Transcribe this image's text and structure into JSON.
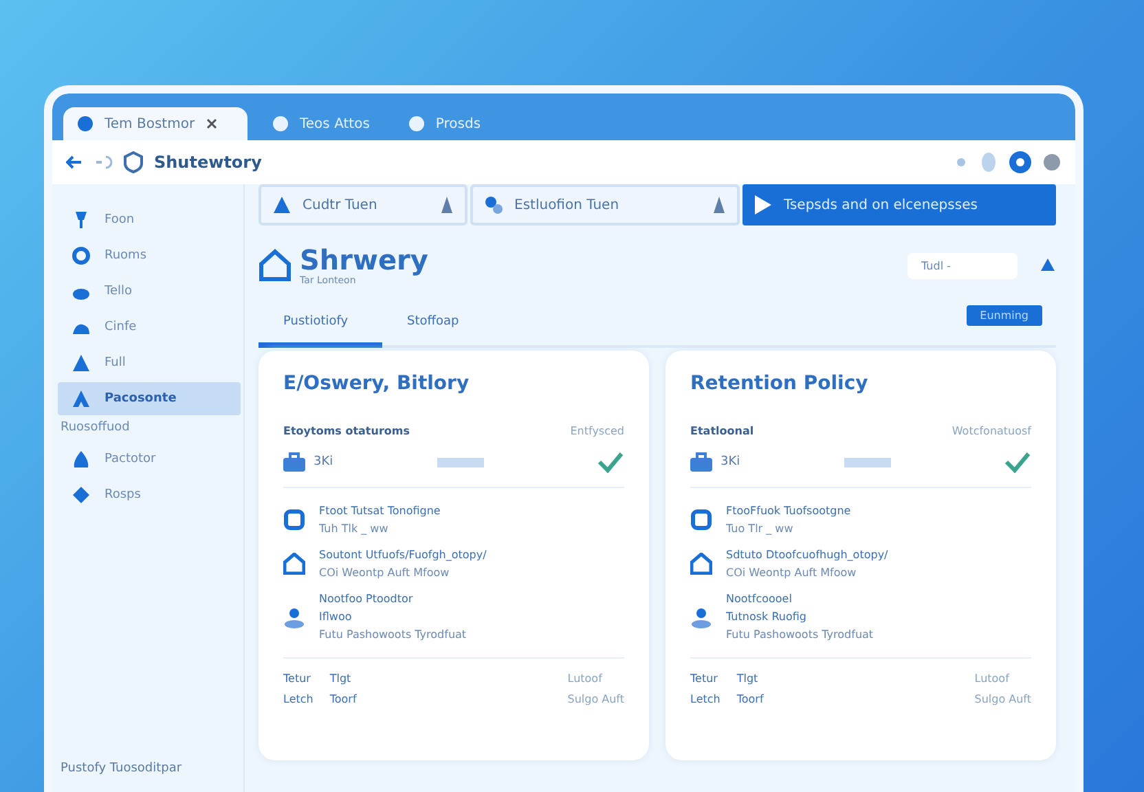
{
  "browser": {
    "tabs": [
      {
        "label": "Tem Bostmor",
        "selected": true,
        "closable": true
      },
      {
        "label": "Teos Attos",
        "selected": false,
        "closable": false
      },
      {
        "label": "Prosds",
        "selected": false,
        "closable": false
      }
    ],
    "address": "Shutewtory"
  },
  "sidebar": {
    "items": [
      {
        "label": "Foon",
        "kind": "item",
        "selected": false
      },
      {
        "label": "Ruoms",
        "kind": "item",
        "selected": false
      },
      {
        "label": "Tello",
        "kind": "item",
        "selected": false
      },
      {
        "label": "Cinfe",
        "kind": "item",
        "selected": false
      },
      {
        "label": "Full",
        "kind": "item",
        "selected": false
      },
      {
        "label": "Pacosonte",
        "kind": "item",
        "selected": true
      },
      {
        "label": "Ruosoffuod",
        "kind": "heading"
      },
      {
        "label": "Pactotor",
        "kind": "item",
        "selected": false
      },
      {
        "label": "Rosps",
        "kind": "item",
        "selected": false
      }
    ],
    "footer": "Pustofy Tuosoditpar"
  },
  "toolbar": {
    "fields": [
      {
        "value": "Cudtr Tuen"
      },
      {
        "value": "Estluofion Tuen"
      }
    ],
    "action": "Tsepsds and on elcenepsses"
  },
  "header": {
    "title": "Shrwery",
    "subtitle": "Tar Lonteon",
    "select": "Tudl -"
  },
  "tabs": [
    {
      "label": "Pustiotiofy",
      "selected": true
    },
    {
      "label": "Stoffoap",
      "selected": false
    }
  ],
  "status_button": "Eunming",
  "cards": [
    {
      "title": "E/Oswery, Bitlory",
      "label": "Etoytoms otaturoms",
      "label_right": "Entfysced",
      "value": "3Ki",
      "ok": true,
      "entries": [
        {
          "lines": [
            "Ftoot Tutsat Tonofigne",
            "Tuh Tlk _ ww"
          ]
        },
        {
          "lines": [
            "Soutont Utfuofs/Fuofgh_otopy/",
            "COi Weontp Auft Mfoow"
          ]
        },
        {
          "lines": [
            "Nootfoo Ptoodtor",
            "Iflwoo",
            "Futu Pashowoots Tyrodfuat"
          ]
        }
      ],
      "footer": [
        [
          "Tetur",
          "Tlgt"
        ],
        [
          "Letch",
          "Toorf"
        ]
      ],
      "footer_right": [
        "Lutoof",
        "Sulgo Auft"
      ]
    },
    {
      "title": "Retention Policy",
      "label": "Etatloonal",
      "label_right": "Wotcfonatuosf",
      "value": "3Ki",
      "ok": true,
      "entries": [
        {
          "lines": [
            "FtooFfuok Tuofsootgne",
            "Tuo Tlr _ ww"
          ]
        },
        {
          "lines": [
            "Sdtuto Dtoofcuofhugh_otopy/",
            "COi Weontp Auft Mfoow"
          ]
        },
        {
          "lines": [
            "Nootfcoooel",
            "Tutnosk Ruofig",
            "Futu Pashowoots Tyrodfuat"
          ]
        }
      ],
      "footer": [
        [
          "Tetur",
          "Tlgt"
        ],
        [
          "Letch",
          "Toorf"
        ]
      ],
      "footer_right": [
        "Lutoof",
        "Sulgo Auft"
      ]
    }
  ]
}
